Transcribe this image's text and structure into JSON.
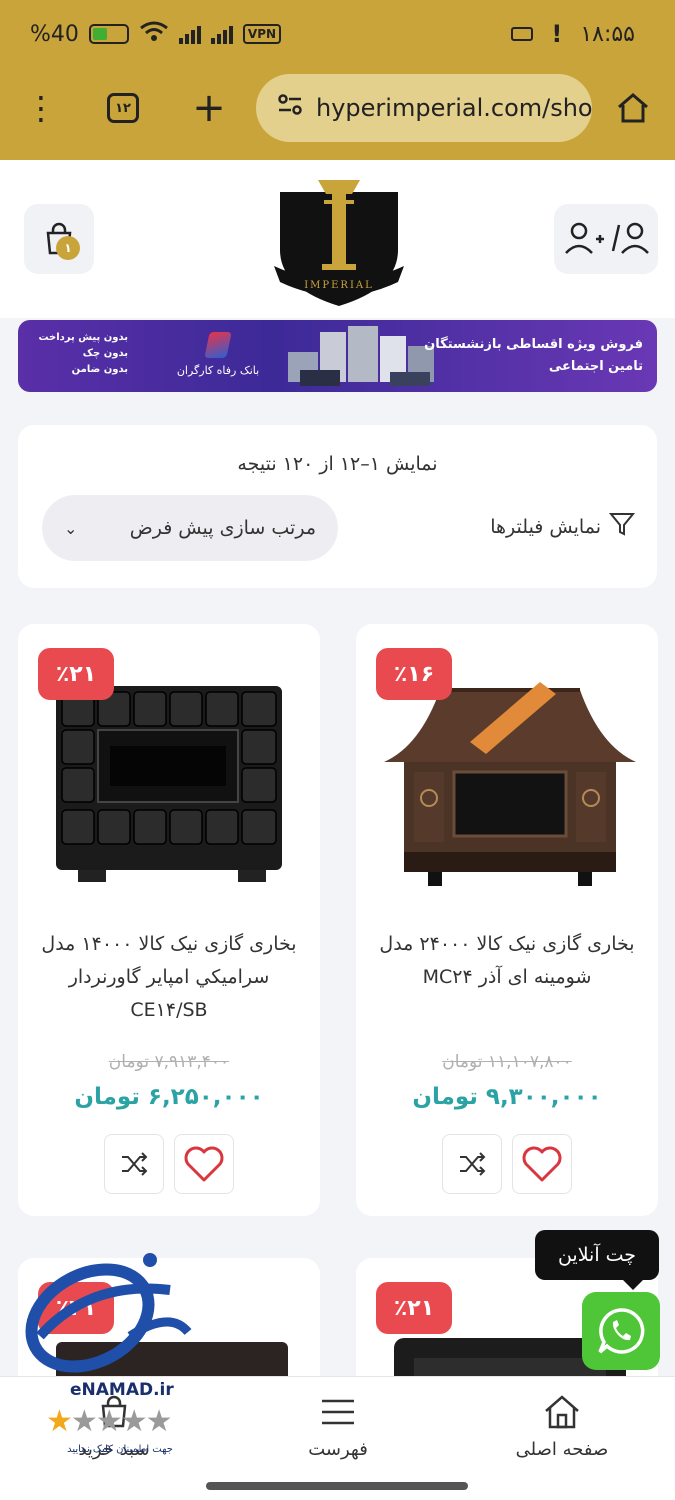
{
  "status_bar": {
    "battery": "%40",
    "time": "۱۸:۵۵",
    "vpn": "VPN"
  },
  "browser": {
    "tab_count": "۱۲",
    "url": "hyperimperial.com/shop"
  },
  "header": {
    "cart_badge": "۱",
    "logo_alt_text": "IMPERIAL"
  },
  "banner": {
    "headline_line1": "فروش ویژه اقساطی بازنشستگان",
    "headline_line2": "تامین اجتماعی",
    "bank_name": "بانک رفاه کارگران",
    "terms": [
      "بدون پیش پرداخت",
      "بدون چک",
      "بدون ضامن"
    ]
  },
  "results": {
    "count_text": "نمایش ۱–۱۲ از ۱۲۰ نتیجه",
    "sort_label": "مرتب سازی پیش فرض",
    "filter_label": "نمایش فیلترها"
  },
  "products": [
    {
      "discount": "٪۲۱",
      "title": "بخاری گازی نیک کالا ۱۴۰۰۰ مدل سرامیکي امپایر گاورنردار CE۱۴/SB",
      "old_price": "۷,۹۱۳,۴۰۰ تومان",
      "price": "۶,۲۵۰,۰۰۰ تومان"
    },
    {
      "discount": "٪۱۶",
      "title": "بخاری گازی نیک کالا ۲۴۰۰۰ مدل شومینه ای آذر MC۲۴",
      "old_price": "۱۱,۱۰۷,۸۰۰ تومان",
      "price": "۹,۳۰۰,۰۰۰ تومان"
    },
    {
      "discount": "٪۲۱"
    },
    {
      "discount": "٪۲۱"
    }
  ],
  "chat": {
    "label": "چت آنلاین"
  },
  "enamad": {
    "brand": "eNAMAD.ir",
    "subtitle": "جهت اطمینان کلیک نمایید",
    "stars_filled": 1,
    "stars_total": 5
  },
  "bottom_nav": {
    "home": "صفحه اصلی",
    "menu": "فهرست",
    "cart": "سبد خرید"
  },
  "colors": {
    "brand_gold": "#c9a43b",
    "price_teal": "#2ba3a5",
    "discount_red": "#e94a4f",
    "whatsapp_green": "#4fc637"
  }
}
